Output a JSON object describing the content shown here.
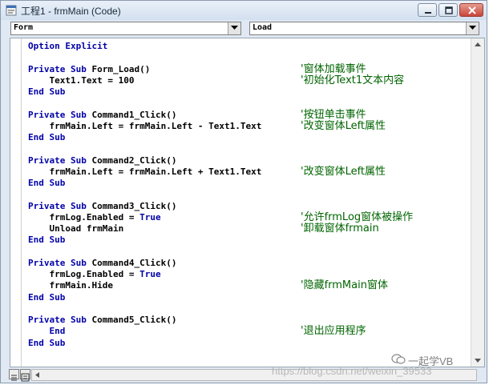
{
  "window": {
    "title": "工程1 - frmMain (Code)"
  },
  "combos": {
    "object": "Form",
    "procedure": "Load"
  },
  "code_lines": [
    {
      "kw": "Option Explicit",
      "rest": "",
      "comment": ""
    },
    {
      "kw": "",
      "rest": "",
      "comment": ""
    },
    {
      "kw": "Private Sub",
      "rest": " Form_Load()",
      "comment": "'窗体加载事件"
    },
    {
      "kw": "",
      "rest": "    Text1.Text = 100",
      "comment": "'初始化Text1文本内容"
    },
    {
      "kw": "End Sub",
      "rest": "",
      "comment": ""
    },
    {
      "kw": "",
      "rest": "",
      "comment": ""
    },
    {
      "kw": "Private Sub",
      "rest": " Command1_Click()",
      "comment": "'按钮单击事件"
    },
    {
      "kw": "",
      "rest": "    frmMain.Left = frmMain.Left - Text1.Text",
      "comment": "'改变窗体Left属性"
    },
    {
      "kw": "End Sub",
      "rest": "",
      "comment": ""
    },
    {
      "kw": "",
      "rest": "",
      "comment": ""
    },
    {
      "kw": "Private Sub",
      "rest": " Command2_Click()",
      "comment": ""
    },
    {
      "kw": "",
      "rest": "    frmMain.Left = frmMain.Left + Text1.Text",
      "comment": "'改变窗体Left属性"
    },
    {
      "kw": "End Sub",
      "rest": "",
      "comment": ""
    },
    {
      "kw": "",
      "rest": "",
      "comment": ""
    },
    {
      "kw": "Private Sub",
      "rest": " Command3_Click()",
      "comment": ""
    },
    {
      "kw": "",
      "rest": "    frmLog.Enabled = ",
      "kw2": "True",
      "comment": "'允许frmLog窗体被操作"
    },
    {
      "kw": "",
      "rest": "    Unload frmMain",
      "comment": "'卸载窗体frmain"
    },
    {
      "kw": "End Sub",
      "rest": "",
      "comment": ""
    },
    {
      "kw": "",
      "rest": "",
      "comment": ""
    },
    {
      "kw": "Private Sub",
      "rest": " Command4_Click()",
      "comment": ""
    },
    {
      "kw": "",
      "rest": "    frmLog.Enabled = ",
      "kw2": "True",
      "comment": ""
    },
    {
      "kw": "",
      "rest": "    frmMain.Hide",
      "comment": "'隐藏frmMain窗体"
    },
    {
      "kw": "End Sub",
      "rest": "",
      "comment": ""
    },
    {
      "kw": "",
      "rest": "",
      "comment": ""
    },
    {
      "kw": "Private Sub",
      "rest": " Command5_Click()",
      "comment": ""
    },
    {
      "kw": "    End",
      "rest": "",
      "comment": "'退出应用程序"
    },
    {
      "kw": "End Sub",
      "rest": "",
      "comment": ""
    }
  ],
  "watermark": "https://blog.csdn.net/weixin_39533",
  "brand": "一起学VB",
  "colors": {
    "keyword": "#0000a8",
    "comment": "#006400"
  }
}
